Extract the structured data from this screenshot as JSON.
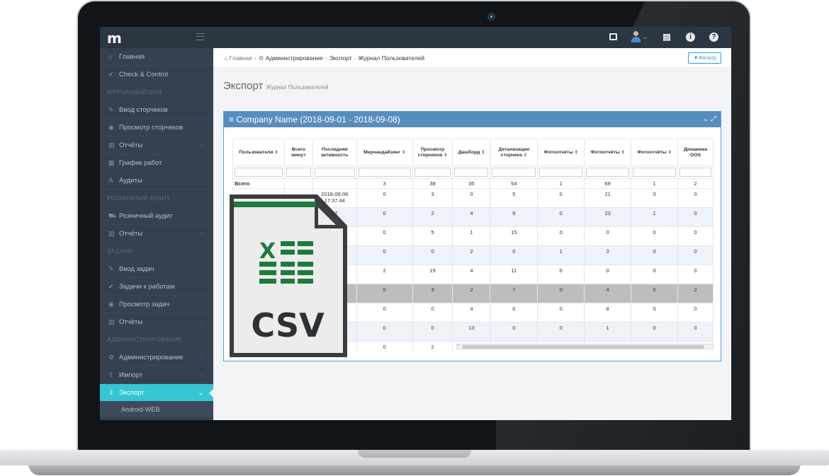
{
  "topbar": {
    "logo": "m",
    "icons": [
      "window-icon",
      "user-avatar-icon",
      "chevron-down-icon",
      "youtube-icon",
      "info-icon",
      "help-icon"
    ]
  },
  "sidebar": {
    "items": [
      {
        "label": "Главная",
        "icon": "home-icon"
      },
      {
        "label": "Check & Control",
        "icon": "check-icon"
      },
      {
        "header": "МЕРЧАНДАЙЗИНГ"
      },
      {
        "label": "Ввод сторчеков",
        "icon": "edit-icon"
      },
      {
        "label": "Просмотр сторчеков",
        "icon": "eye-icon"
      },
      {
        "label": "Отчёты",
        "icon": "bar-chart-icon"
      },
      {
        "label": "График работ",
        "icon": "calendar-icon"
      },
      {
        "label": "Аудиты",
        "icon": "font-icon"
      },
      {
        "header": "РОЗНИЧНЫЙ АУДИТ"
      },
      {
        "label": "Розничный аудит",
        "icon": "cart-icon"
      },
      {
        "label": "Отчёты",
        "icon": "bar-chart-icon"
      },
      {
        "header": "ЗАДАЧИ"
      },
      {
        "label": "Ввод задач",
        "icon": "edit-icon"
      },
      {
        "label": "Задачи к работам",
        "icon": "check-icon"
      },
      {
        "label": "Просмотр задач",
        "icon": "eye-icon"
      },
      {
        "label": "Отчёты",
        "icon": "bar-chart-icon"
      },
      {
        "header": "АДМИНИСТРИРОВАНИЕ"
      },
      {
        "label": "Администрирование",
        "icon": "cogs-icon"
      },
      {
        "label": "Импорт",
        "icon": "upload-icon"
      },
      {
        "label": "Экспорт",
        "icon": "download-icon",
        "active": true
      }
    ],
    "sub_item": "Android-WEB"
  },
  "breadcrumb": {
    "home": "Главная",
    "admin": "Администрирование",
    "export": "Экспорт",
    "current": "Журнал Пользователей"
  },
  "filter_button": "Фильтр",
  "page_title": {
    "main": "Экспорт",
    "sub": "Журнал Пользователей"
  },
  "portlet": {
    "title": "Company Name (2018-09-01 - 2018-09-08)"
  },
  "table": {
    "headers": [
      "Пользователи",
      "Всего минут",
      "Последняя активность",
      "Мерчандайзинг",
      "Просмотр сторчеков",
      "Дашборд",
      "Детализация сторчека",
      "Фотоотчёты",
      "Фотоотчёты",
      "Фотоотчёты",
      "Динамика OOS"
    ],
    "total_label": "Всего",
    "total": [
      "",
      "",
      "3",
      "38",
      "35",
      "54",
      "1",
      "69",
      "1",
      "2"
    ],
    "rows": [
      [
        "",
        "",
        "2018-09-06 17:37:44",
        "0",
        "3",
        "0",
        "5",
        "0",
        "21",
        "0",
        "0"
      ],
      [
        "",
        "",
        "07",
        "0",
        "2",
        "4",
        "9",
        "0",
        "23",
        "1",
        "0"
      ],
      [
        "",
        "",
        "3",
        "0",
        "5",
        "1",
        "15",
        "0",
        "0",
        "0",
        "0"
      ],
      [
        "",
        "",
        "7",
        "0",
        "0",
        "2",
        "0",
        "1",
        "3",
        "0",
        "0"
      ],
      [
        "",
        "",
        "6",
        "2",
        "19",
        "4",
        "11",
        "0",
        "0",
        "0",
        "0"
      ],
      [
        "",
        "",
        "4",
        "0",
        "3",
        "2",
        "7",
        "0",
        "4",
        "0",
        "2"
      ],
      [
        "",
        "",
        "3",
        "0",
        "0",
        "4",
        "0",
        "0",
        "8",
        "0",
        "0"
      ],
      [
        "",
        "",
        "3",
        "0",
        "0",
        "13",
        "0",
        "0",
        "1",
        "0",
        "0"
      ],
      [
        "",
        "",
        "3",
        "0",
        "2",
        "1",
        "5",
        "0",
        "5",
        "0",
        "0"
      ]
    ]
  },
  "overlay": {
    "label": "CSV",
    "accent": "#1e7a3c",
    "icon": "excel-spreadsheet-icon"
  }
}
